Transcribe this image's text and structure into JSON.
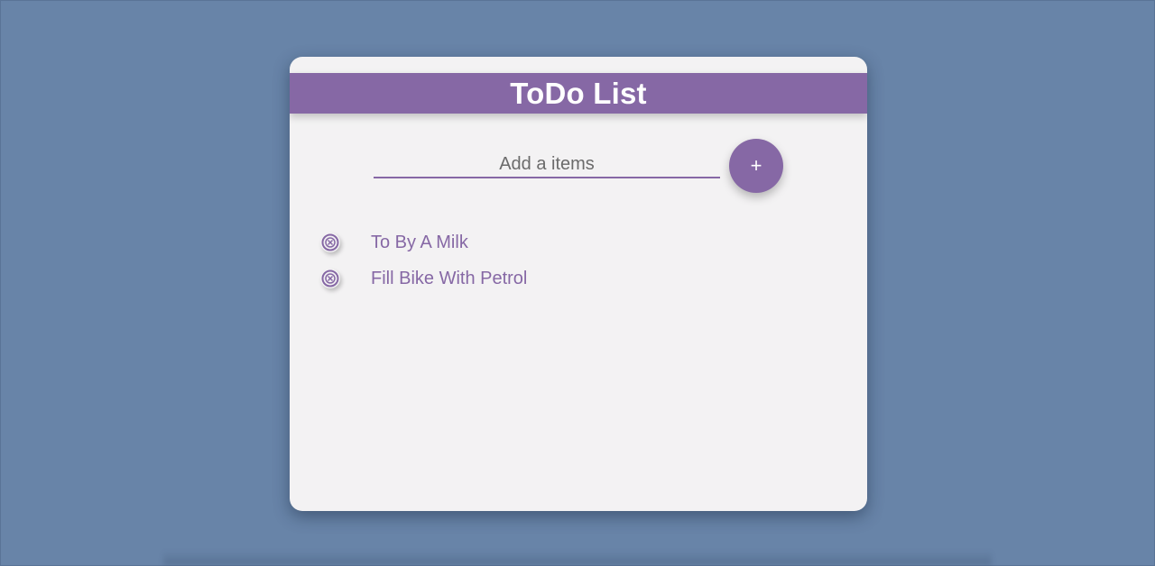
{
  "app": {
    "title": "ToDo List"
  },
  "input": {
    "placeholder": "Add a items",
    "value": ""
  },
  "add_button": {
    "label": "+"
  },
  "items": [
    {
      "text": "To By A Milk",
      "icon": "close-circle-icon"
    },
    {
      "text": "Fill Bike With Petrol",
      "icon": "close-circle-icon"
    }
  ],
  "colors": {
    "accent": "#8668a5",
    "background": "#6884a8",
    "card": "#f3f2f3"
  }
}
